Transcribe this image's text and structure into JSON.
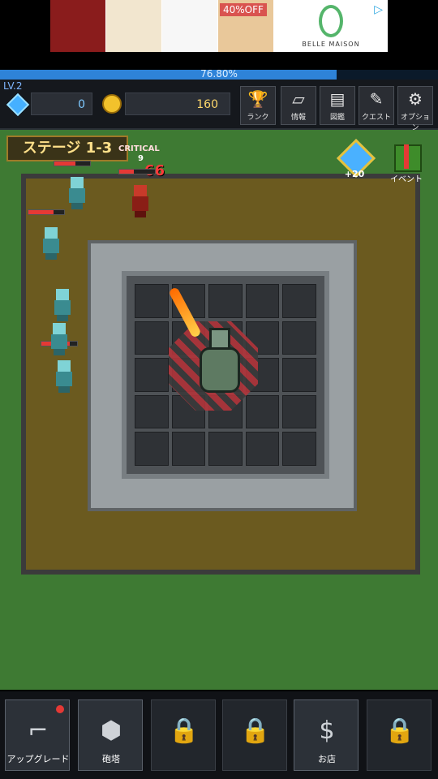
{
  "ad": {
    "badge": "40%OFF",
    "brand": "BELLE MAISON"
  },
  "xp": {
    "percent_text": "76.80%",
    "fill_fraction": 0.768
  },
  "player": {
    "level": "LV.2",
    "gems": "0",
    "coins": "160"
  },
  "menu": [
    {
      "label": "ランク",
      "icon": "trophy-icon"
    },
    {
      "label": "情報",
      "icon": "book-icon"
    },
    {
      "label": "図鑑",
      "icon": "album-icon"
    },
    {
      "label": "クエスト",
      "icon": "scroll-icon"
    },
    {
      "label": "オプション",
      "icon": "gear-icon"
    }
  ],
  "stage": {
    "label": "ステージ 1-3"
  },
  "combat": {
    "critical": "CRITICAL",
    "crit_small": "9",
    "damage": "66"
  },
  "events": {
    "gem_bonus": "+20",
    "event_label": "イベント"
  },
  "bottom": [
    {
      "label": "アップグレード",
      "icon": "upgrade-icon",
      "locked": false,
      "notify": true
    },
    {
      "label": "砲塔",
      "icon": "turret-icon",
      "locked": false,
      "notify": false
    },
    {
      "label": "",
      "icon": "lock-icon",
      "locked": true,
      "notify": false
    },
    {
      "label": "",
      "icon": "lock-icon",
      "locked": true,
      "notify": false
    },
    {
      "label": "お店",
      "icon": "money-bag-icon",
      "locked": false,
      "notify": false
    },
    {
      "label": "",
      "icon": "lock-icon",
      "locked": true,
      "notify": false
    }
  ],
  "colors": {
    "xp_fill": "#2e83d8",
    "grass": "#3e7a33",
    "dirt": "#6b5a1f",
    "coin": "#f2c22c"
  }
}
